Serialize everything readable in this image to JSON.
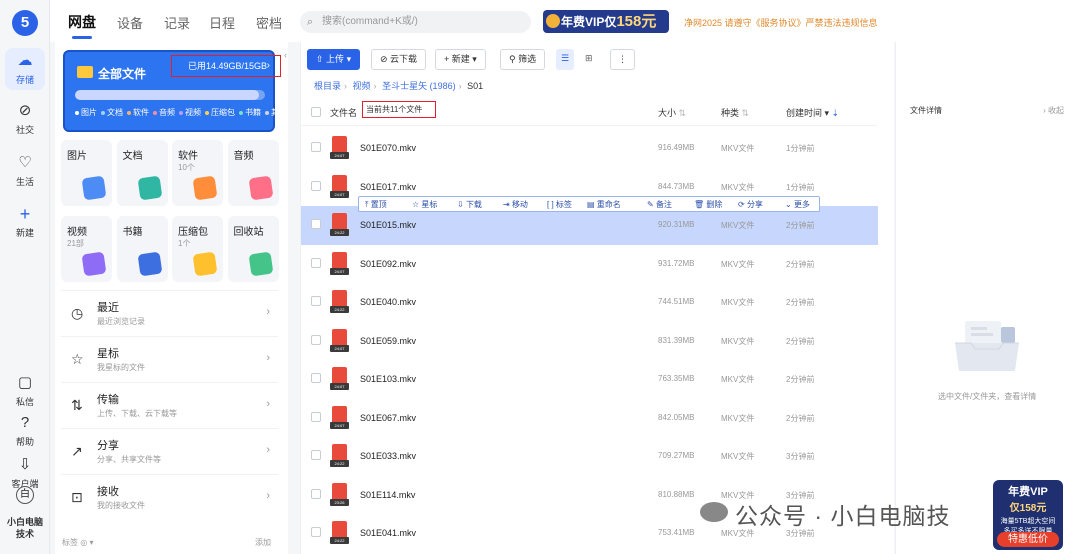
{
  "app": {
    "logo": "5"
  },
  "rail": {
    "items": [
      {
        "label": "存储",
        "icon": "cloud-icon"
      },
      {
        "label": "社交",
        "icon": "compass-icon"
      },
      {
        "label": "生活",
        "icon": "heart-icon"
      },
      {
        "label": "新建",
        "icon": "plus-icon"
      },
      {
        "label": "私信",
        "icon": "message-icon"
      },
      {
        "label": "帮助",
        "icon": "help-icon"
      },
      {
        "label": "客户端",
        "icon": "download-icon"
      }
    ],
    "user_name": "小白电脑技术",
    "user_initial": "白"
  },
  "topnav": {
    "tabs": [
      "网盘",
      "设备",
      "记录",
      "日程",
      "密档"
    ],
    "search_placeholder": "搜索(command+K或/)",
    "vip_text": "年费VIP仅",
    "vip_price": "158元",
    "notice": "净网2025 请遵守《服务协议》严禁违法违规信息"
  },
  "storage": {
    "title": "全部文件",
    "usage": "已用14.49GB/15GB",
    "usage_ratio": 0.966,
    "legend": [
      {
        "label": "图片",
        "color": "#ffffff"
      },
      {
        "label": "文档",
        "color": "#9fd1ff"
      },
      {
        "label": "软件",
        "color": "#ffb36b"
      },
      {
        "label": "音频",
        "color": "#ff8a9a"
      },
      {
        "label": "视频",
        "color": "#b59cff"
      },
      {
        "label": "压缩包",
        "color": "#ffd24d"
      },
      {
        "label": "书籍",
        "color": "#7ae0c0"
      },
      {
        "label": "其他",
        "color": "#d0d4dc"
      }
    ]
  },
  "categories": [
    {
      "label": "图片",
      "sub": "",
      "color": "#4d8cf5"
    },
    {
      "label": "文档",
      "sub": "",
      "color": "#2fb7a3"
    },
    {
      "label": "软件",
      "sub": "10个",
      "color": "#ff8d3a"
    },
    {
      "label": "音频",
      "sub": "",
      "color": "#ff6f88"
    },
    {
      "label": "视频",
      "sub": "21部",
      "color": "#8f6cf5"
    },
    {
      "label": "书籍",
      "sub": "",
      "color": "#3d6fe0"
    },
    {
      "label": "压缩包",
      "sub": "1个",
      "color": "#ffc02e"
    },
    {
      "label": "回收站",
      "sub": "",
      "color": "#45c48a"
    }
  ],
  "menu": [
    {
      "title": "最近",
      "sub": "最近浏览记录",
      "icon": "clock-icon"
    },
    {
      "title": "星标",
      "sub": "我星标的文件",
      "icon": "star-icon"
    },
    {
      "title": "传输",
      "sub": "上传、下载、云下载等",
      "icon": "transfer-icon"
    },
    {
      "title": "分享",
      "sub": "分享、共享文件等",
      "icon": "share-icon"
    },
    {
      "title": "接收",
      "sub": "我的接收文件",
      "icon": "inbox-icon"
    }
  ],
  "left_footer": {
    "tags": "标签",
    "add": "添加"
  },
  "toolbar": {
    "upload": "上传",
    "cloud_download": "云下载",
    "new": "新建",
    "filter": "筛选",
    "more": "⋮"
  },
  "breadcrumb": [
    "根目录",
    "视频",
    "圣斗士星矢 (1986)",
    "S01"
  ],
  "table": {
    "headers": {
      "name": "文件名",
      "size": "大小",
      "type": "种类",
      "time": "创建时间"
    },
    "count_text": "当前共11个文件",
    "rows": [
      {
        "name": "S01E070.mkv",
        "size": "916.49MB",
        "type": "MKV文件",
        "time": "1分钟前",
        "tag": "24:07"
      },
      {
        "name": "S01E017.mkv",
        "size": "844.73MB",
        "type": "MKV文件",
        "time": "1分钟前",
        "tag": "24:07"
      },
      {
        "name": "S01E015.mkv",
        "size": "920.31MB",
        "type": "MKV文件",
        "time": "2分钟前",
        "tag": "24:22"
      },
      {
        "name": "S01E092.mkv",
        "size": "931.72MB",
        "type": "MKV文件",
        "time": "2分钟前",
        "tag": "24:07"
      },
      {
        "name": "S01E040.mkv",
        "size": "744.51MB",
        "type": "MKV文件",
        "time": "2分钟前",
        "tag": "24:22"
      },
      {
        "name": "S01E059.mkv",
        "size": "831.39MB",
        "type": "MKV文件",
        "time": "2分钟前",
        "tag": "24:07"
      },
      {
        "name": "S01E103.mkv",
        "size": "763.35MB",
        "type": "MKV文件",
        "time": "2分钟前",
        "tag": "24:07"
      },
      {
        "name": "S01E067.mkv",
        "size": "842.05MB",
        "type": "MKV文件",
        "time": "2分钟前",
        "tag": "24:07"
      },
      {
        "name": "S01E033.mkv",
        "size": "709.27MB",
        "type": "MKV文件",
        "time": "3分钟前",
        "tag": "24:22"
      },
      {
        "name": "S01E114.mkv",
        "size": "810.88MB",
        "type": "MKV文件",
        "time": "3分钟前",
        "tag": "23:26"
      },
      {
        "name": "S01E041.mkv",
        "size": "753.41MB",
        "type": "MKV文件",
        "time": "3分钟前",
        "tag": "24:22"
      }
    ]
  },
  "actions": [
    "置顶",
    "星标",
    "下载",
    "移动",
    "标签",
    "重命名",
    "备注",
    "删除",
    "分享",
    "更多"
  ],
  "detail": {
    "title": "文件详情",
    "collapse": "收起",
    "hint": "选中文件/文件夹，查看详情"
  },
  "overlay": {
    "watermark": "公众号 · 小白电脑技",
    "ad_line1": "年费VIP",
    "ad_line2": "仅158元",
    "ad_line3": "海量5TB超大空间",
    "ad_line4": "多买多送不限量",
    "ad_button": "特惠低价"
  }
}
